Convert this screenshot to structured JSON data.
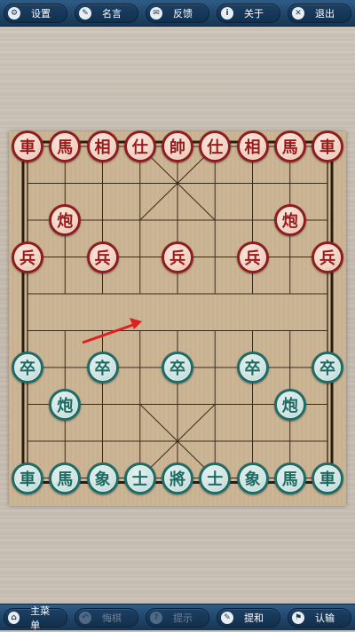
{
  "top_menu": [
    {
      "label": "设置",
      "icon": "gear-icon",
      "glyph": "⚙"
    },
    {
      "label": "名言",
      "icon": "speech-bubble-icon",
      "glyph": "✎"
    },
    {
      "label": "反馈",
      "icon": "mail-icon",
      "glyph": "✉"
    },
    {
      "label": "关于",
      "icon": "info-icon",
      "glyph": "i"
    },
    {
      "label": "退出",
      "icon": "close-icon",
      "glyph": "✕"
    }
  ],
  "bottom_menu": [
    {
      "label": "主菜单",
      "icon": "home-icon",
      "glyph": "⌂",
      "enabled": true
    },
    {
      "label": "悔棋",
      "icon": "undo-icon",
      "glyph": "↶",
      "enabled": false
    },
    {
      "label": "提示",
      "icon": "hint-icon",
      "glyph": "?",
      "enabled": false
    },
    {
      "label": "提和",
      "icon": "pen-icon",
      "glyph": "✎",
      "enabled": true
    },
    {
      "label": "认输",
      "icon": "flag-icon",
      "glyph": "⚑",
      "enabled": true
    }
  ],
  "red_pieces": [
    {
      "label": "車",
      "file": 0,
      "rank": 0
    },
    {
      "label": "馬",
      "file": 1,
      "rank": 0
    },
    {
      "label": "相",
      "file": 2,
      "rank": 0
    },
    {
      "label": "仕",
      "file": 3,
      "rank": 0
    },
    {
      "label": "帥",
      "file": 4,
      "rank": 0
    },
    {
      "label": "仕",
      "file": 5,
      "rank": 0
    },
    {
      "label": "相",
      "file": 6,
      "rank": 0
    },
    {
      "label": "馬",
      "file": 7,
      "rank": 0
    },
    {
      "label": "車",
      "file": 8,
      "rank": 0
    },
    {
      "label": "炮",
      "file": 1,
      "rank": 2
    },
    {
      "label": "炮",
      "file": 7,
      "rank": 2
    },
    {
      "label": "兵",
      "file": 0,
      "rank": 3
    },
    {
      "label": "兵",
      "file": 2,
      "rank": 3
    },
    {
      "label": "兵",
      "file": 4,
      "rank": 3
    },
    {
      "label": "兵",
      "file": 6,
      "rank": 3
    },
    {
      "label": "兵",
      "file": 8,
      "rank": 3
    }
  ],
  "green_pieces": [
    {
      "label": "卒",
      "file": 0,
      "rank": 6
    },
    {
      "label": "卒",
      "file": 2,
      "rank": 6
    },
    {
      "label": "卒",
      "file": 4,
      "rank": 6
    },
    {
      "label": "卒",
      "file": 6,
      "rank": 6
    },
    {
      "label": "卒",
      "file": 8,
      "rank": 6
    },
    {
      "label": "炮",
      "file": 1,
      "rank": 7
    },
    {
      "label": "炮",
      "file": 7,
      "rank": 7
    },
    {
      "label": "車",
      "file": 0,
      "rank": 9
    },
    {
      "label": "馬",
      "file": 1,
      "rank": 9
    },
    {
      "label": "象",
      "file": 2,
      "rank": 9
    },
    {
      "label": "士",
      "file": 3,
      "rank": 9
    },
    {
      "label": "將",
      "file": 4,
      "rank": 9
    },
    {
      "label": "士",
      "file": 5,
      "rank": 9
    },
    {
      "label": "象",
      "file": 6,
      "rank": 9
    },
    {
      "label": "馬",
      "file": 7,
      "rank": 9
    },
    {
      "label": "車",
      "file": 8,
      "rank": 9
    }
  ],
  "colors": {
    "red_piece": "#9a1b1b",
    "green_piece": "#1d6a63",
    "arrow": "#e02020",
    "toolbar": "#1e4367"
  }
}
